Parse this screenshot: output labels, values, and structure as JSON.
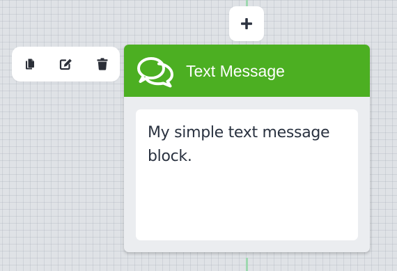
{
  "canvas": {
    "background_color": "#dfe2e6",
    "connector_color": "#9ed8b0"
  },
  "add_button": {
    "icon": "plus-icon"
  },
  "toolbar": {
    "actions": [
      {
        "name": "duplicate",
        "icon": "copy-icon"
      },
      {
        "name": "edit",
        "icon": "edit-icon"
      },
      {
        "name": "delete",
        "icon": "trash-icon"
      }
    ]
  },
  "card": {
    "title": "Text Message",
    "icon": "chat-bubbles-icon",
    "header_color": "#4caf22",
    "message": "My simple text message block."
  }
}
